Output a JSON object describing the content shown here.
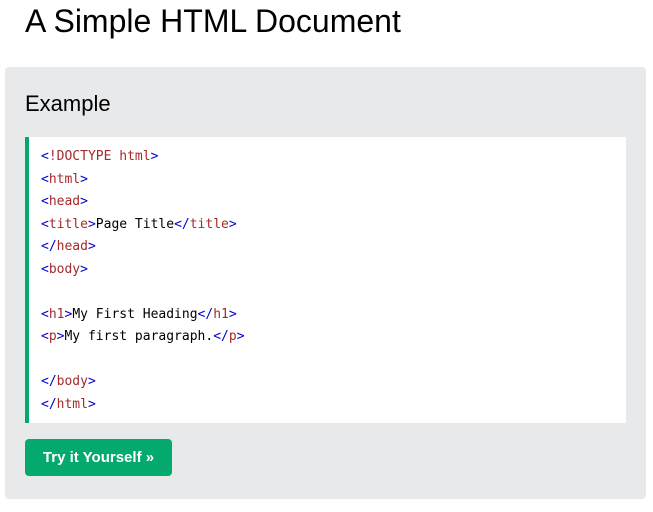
{
  "page": {
    "title": "A Simple HTML Document"
  },
  "example": {
    "heading": "Example",
    "code_lines": [
      [
        {
          "t": "<",
          "c": "bracket"
        },
        {
          "t": "!DOCTYPE",
          "c": "tag"
        },
        {
          "t": " html",
          "c": "tagname"
        },
        {
          "t": ">",
          "c": "bracket"
        }
      ],
      [
        {
          "t": "<",
          "c": "bracket"
        },
        {
          "t": "html",
          "c": "tag"
        },
        {
          "t": ">",
          "c": "bracket"
        }
      ],
      [
        {
          "t": "<",
          "c": "bracket"
        },
        {
          "t": "head",
          "c": "tag"
        },
        {
          "t": ">",
          "c": "bracket"
        }
      ],
      [
        {
          "t": "<",
          "c": "bracket"
        },
        {
          "t": "title",
          "c": "tag"
        },
        {
          "t": ">",
          "c": "bracket"
        },
        {
          "t": "Page Title",
          "c": "text"
        },
        {
          "t": "</",
          "c": "bracket"
        },
        {
          "t": "title",
          "c": "tag"
        },
        {
          "t": ">",
          "c": "bracket"
        }
      ],
      [
        {
          "t": "</",
          "c": "bracket"
        },
        {
          "t": "head",
          "c": "tag"
        },
        {
          "t": ">",
          "c": "bracket"
        }
      ],
      [
        {
          "t": "<",
          "c": "bracket"
        },
        {
          "t": "body",
          "c": "tag"
        },
        {
          "t": ">",
          "c": "bracket"
        }
      ],
      [],
      [
        {
          "t": "<",
          "c": "bracket"
        },
        {
          "t": "h1",
          "c": "tag"
        },
        {
          "t": ">",
          "c": "bracket"
        },
        {
          "t": "My First Heading",
          "c": "text"
        },
        {
          "t": "</",
          "c": "bracket"
        },
        {
          "t": "h1",
          "c": "tag"
        },
        {
          "t": ">",
          "c": "bracket"
        }
      ],
      [
        {
          "t": "<",
          "c": "bracket"
        },
        {
          "t": "p",
          "c": "tag"
        },
        {
          "t": ">",
          "c": "bracket"
        },
        {
          "t": "My first paragraph.",
          "c": "text"
        },
        {
          "t": "</",
          "c": "bracket"
        },
        {
          "t": "p",
          "c": "tag"
        },
        {
          "t": ">",
          "c": "bracket"
        }
      ],
      [],
      [
        {
          "t": "</",
          "c": "bracket"
        },
        {
          "t": "body",
          "c": "tag"
        },
        {
          "t": ">",
          "c": "bracket"
        }
      ],
      [
        {
          "t": "</",
          "c": "bracket"
        },
        {
          "t": "html",
          "c": "tag"
        },
        {
          "t": ">",
          "c": "bracket"
        }
      ]
    ],
    "button_label": "Try it Yourself »"
  },
  "colors": {
    "accent_green": "#04aa6d",
    "panel_background": "#e7e9eb",
    "code_tag": "#a52a2a",
    "code_bracket": "#0000cd"
  }
}
